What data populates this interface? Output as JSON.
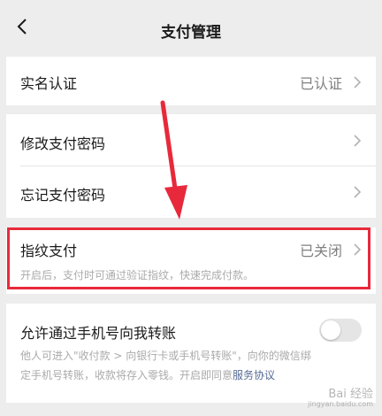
{
  "nav": {
    "title": "支付管理"
  },
  "rows": {
    "real_name": {
      "label": "实名认证",
      "value": "已认证"
    },
    "change_password": {
      "label": "修改支付密码"
    },
    "forgot_password": {
      "label": "忘记支付密码"
    },
    "fingerprint": {
      "label": "指纹支付",
      "value": "已关闭",
      "description": "开启后，支付时可通过验证指纹，快速完成付款。"
    },
    "phone_transfer": {
      "label": "允许通过手机号向我转账",
      "toggle_on": false,
      "description_line1": "他人可进入\"收付款 > 向银行卡或手机号转账\"，向你的微信绑",
      "description_line2": "定手机号转账，收款将存入零钱。开启即同意",
      "link": "服务协议"
    }
  },
  "watermark": {
    "text": "Bai 经验",
    "sub": "jingyan.baidu.com"
  },
  "colors": {
    "background": "#ededed",
    "card": "#ffffff",
    "highlight": "#e8293b",
    "link": "#576b95"
  }
}
